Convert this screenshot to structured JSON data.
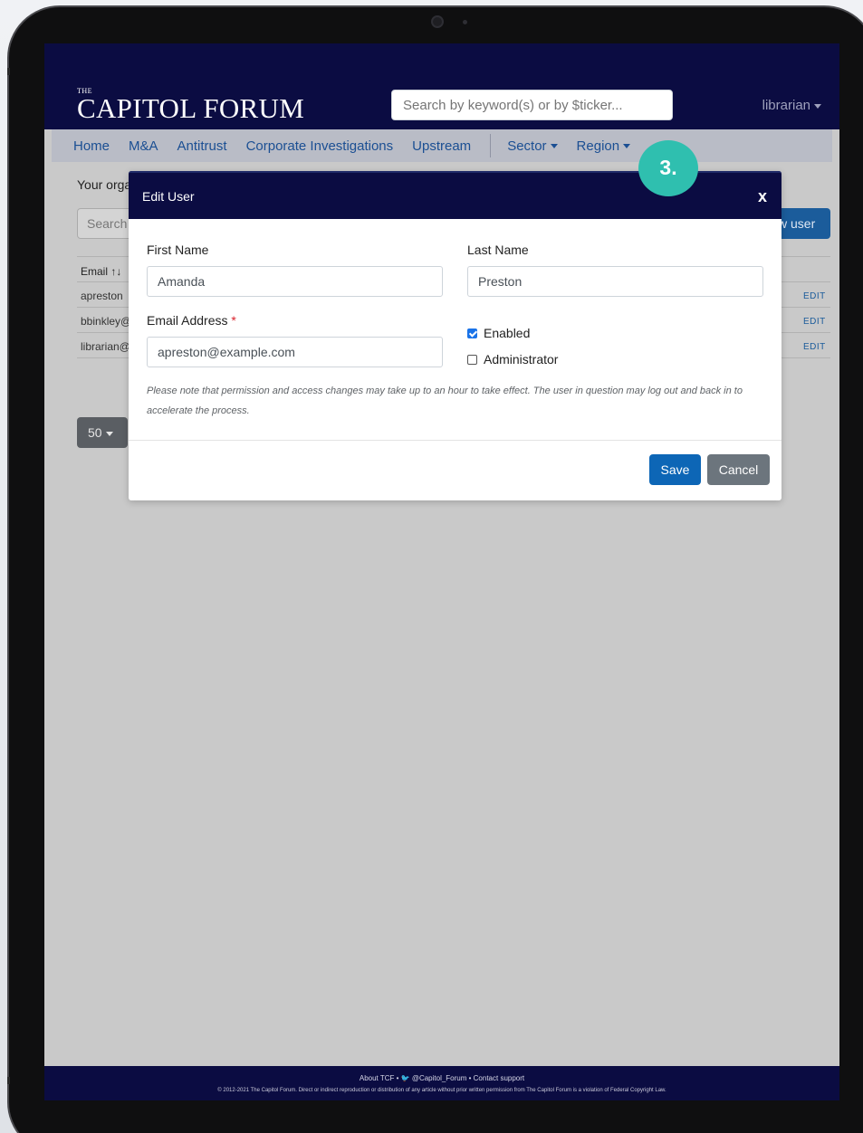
{
  "topbar": {
    "logo_small": "THE",
    "logo": "CAPITOL FORUM",
    "search_placeholder": "Search by keyword(s) or by $ticker...",
    "user_label": "librarian"
  },
  "nav": {
    "items": [
      "Home",
      "M&A",
      "Antitrust",
      "Corporate Investigations",
      "Upstream"
    ],
    "dropdowns": [
      "Sector",
      "Region"
    ]
  },
  "page": {
    "org_text": "Your orga",
    "search_placeholder": "Search",
    "new_user_label": "w user",
    "column_email": "Email ↑↓",
    "rows": [
      {
        "email": "apreston",
        "action": "EDIT"
      },
      {
        "email": "bbinkley@",
        "action": "EDIT"
      },
      {
        "email": "librarian@",
        "action": "EDIT"
      }
    ],
    "per_page": "50"
  },
  "modal": {
    "title": "Edit User",
    "close": "x",
    "first_name_label": "First Name",
    "first_name_value": "Amanda",
    "last_name_label": "Last Name",
    "last_name_value": "Preston",
    "email_label": "Email Address",
    "required_marker": "*",
    "email_value": "apreston@example.com",
    "enabled_label": "Enabled",
    "enabled_checked": true,
    "admin_label": "Administrator",
    "admin_checked": false,
    "note": "Please note that permission and access changes may take up to an hour to take effect. The user in question may log out and back in to accelerate the process.",
    "save_label": "Save",
    "cancel_label": "Cancel"
  },
  "step_badge": "3.",
  "footer": {
    "links": "About TCF  •  🐦 @Capitol_Forum  •  Contact support",
    "copyright": "© 2012-2021 The Capitol Forum. Direct or indirect reproduction or distribution of any article without prior written permission from The Capitol Forum is a violation of Federal Copyright Law."
  },
  "colors": {
    "navy": "#0b0c42",
    "primary": "#0d66b6",
    "secondary": "#6c757d",
    "badge": "#2fbfaf",
    "required": "#d9232d"
  }
}
